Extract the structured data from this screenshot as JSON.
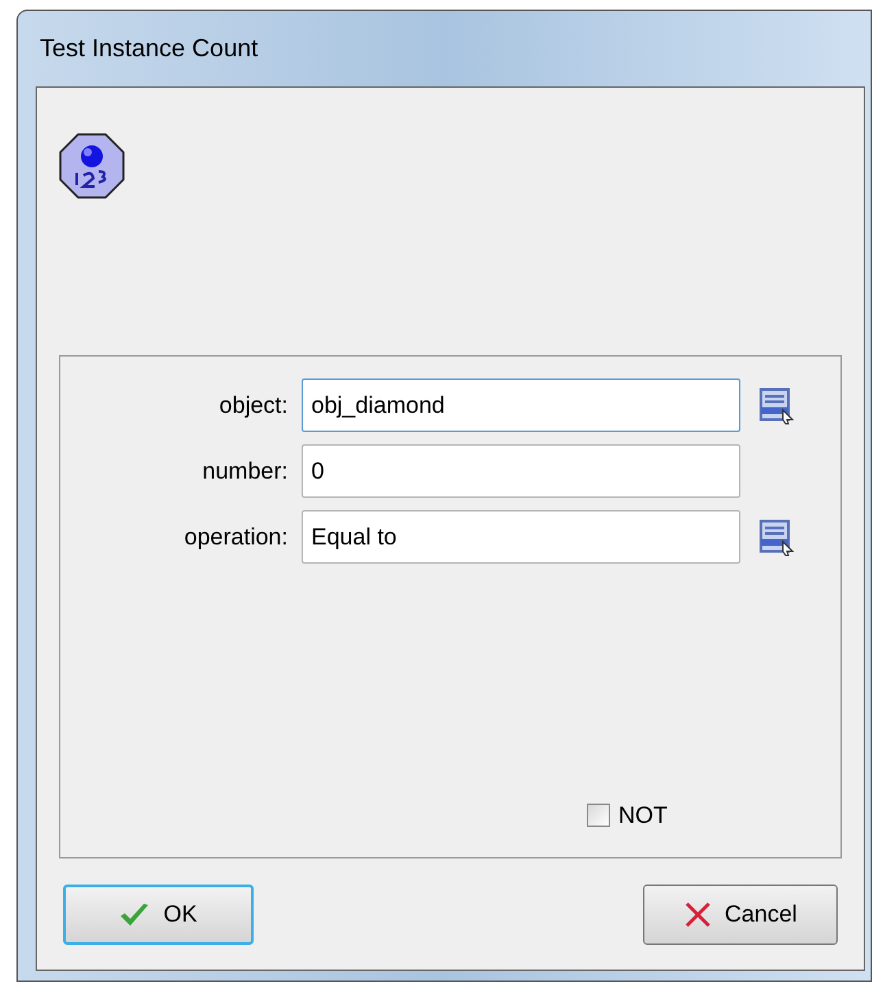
{
  "window": {
    "title": "Test Instance Count"
  },
  "fields": [
    {
      "label": "object:",
      "value": "obj_diamond",
      "kind": "menu",
      "focused": true
    },
    {
      "label": "number:",
      "value": "0",
      "kind": "text",
      "focused": false
    },
    {
      "label": "operation:",
      "value": "Equal to",
      "kind": "menu",
      "focused": false
    }
  ],
  "not_checkbox": {
    "label": "NOT",
    "checked": false
  },
  "buttons": [
    {
      "label": "OK",
      "kind": "ok",
      "default": true
    },
    {
      "label": "Cancel",
      "kind": "cancel",
      "default": false
    }
  ]
}
